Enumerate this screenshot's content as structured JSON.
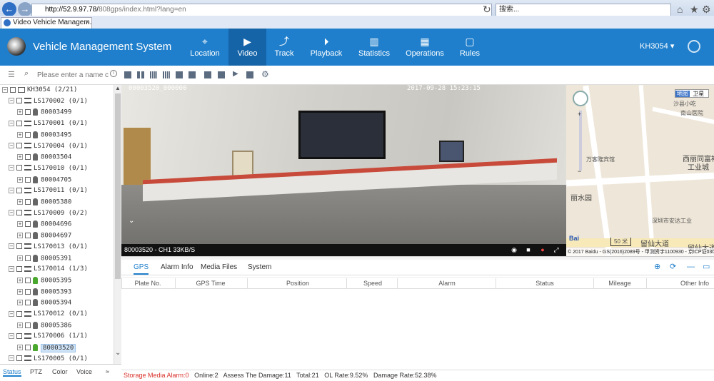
{
  "browser": {
    "url_host": "http://52.9.97.78/",
    "url_path": "808gps/index.html?lang=en",
    "search_placeholder": "搜索...",
    "tab_title": "Video Vehicle Managem..."
  },
  "app": {
    "title": "Vehicle Management System"
  },
  "nav": {
    "items": [
      {
        "label": "Location",
        "icon": "map-pin-icon"
      },
      {
        "label": "Video",
        "icon": "play-circle-icon",
        "active": true
      },
      {
        "label": "Track",
        "icon": "track-icon"
      },
      {
        "label": "Playback",
        "icon": "playback-icon"
      },
      {
        "label": "Statistics",
        "icon": "bar-chart-icon"
      },
      {
        "label": "Operations",
        "icon": "operations-icon"
      },
      {
        "label": "Rules",
        "icon": "rules-icon"
      }
    ]
  },
  "user": {
    "name": "KH3054",
    "caret": "▾"
  },
  "toolbar": {
    "search_placeholder": "Please enter a name c"
  },
  "tree": {
    "root": "KH3054  (2/21)",
    "groups": [
      {
        "name": "LS170002  (0/1)",
        "devices": [
          {
            "id": "80003499",
            "online": false
          }
        ]
      },
      {
        "name": "LS170001  (0/1)",
        "devices": [
          {
            "id": "80003495",
            "online": false
          }
        ]
      },
      {
        "name": "LS170004  (0/1)",
        "devices": [
          {
            "id": "80003504",
            "online": false
          }
        ]
      },
      {
        "name": "LS170010  (0/1)",
        "devices": [
          {
            "id": "80004705",
            "online": false
          }
        ]
      },
      {
        "name": "LS170011  (0/1)",
        "devices": [
          {
            "id": "80005380",
            "online": false
          }
        ]
      },
      {
        "name": "LS170009  (0/2)",
        "devices": [
          {
            "id": "80004696",
            "online": false
          },
          {
            "id": "80004697",
            "online": false
          }
        ]
      },
      {
        "name": "LS170013  (0/1)",
        "devices": [
          {
            "id": "80005391",
            "online": false
          }
        ]
      },
      {
        "name": "LS170014  (1/3)",
        "devices": [
          {
            "id": "80005395",
            "online": true
          },
          {
            "id": "80005393",
            "online": false
          },
          {
            "id": "80005394",
            "online": false
          }
        ]
      },
      {
        "name": "LS170012  (0/1)",
        "devices": [
          {
            "id": "80005386",
            "online": false
          }
        ]
      },
      {
        "name": "LS170006  (1/1)",
        "devices": [
          {
            "id": "80003520",
            "online": true,
            "selected": true
          }
        ]
      },
      {
        "name": "LS170005  (0/1)",
        "devices": []
      }
    ]
  },
  "left_tabs": [
    "Status",
    "PTZ",
    "Color",
    "Voice"
  ],
  "video": {
    "osd_channel": "00003520_000000",
    "osd_datetime": "2017-09-28 15:23:15",
    "caption": "80003520 - CH1 33KB/S"
  },
  "map": {
    "type_map": "地图",
    "type_satellite": "卫星",
    "labels": [
      "沙县小吃",
      "南山医院",
      "万客隆宾馆",
      "西丽同富裕",
      "工业城",
      "丽水园",
      "深圳市安达工业",
      "留仙大道",
      "留仙大道"
    ],
    "scale": "50 米",
    "copyright": "© 2017 Baidu - GS(2016)2089号 - 甲测资字1100930 - 京ICP证030173号"
  },
  "detail_tabs": [
    "GPS",
    "Alarm Info",
    "Media Files",
    "System"
  ],
  "table": {
    "columns": [
      "Plate No.",
      "GPS Time",
      "Position",
      "Speed",
      "Alarm",
      "Status",
      "Mileage",
      "Other Info"
    ]
  },
  "status": {
    "alarm": "Storage Media Alarm:0",
    "online": "Online:2",
    "damage": "Assess The Damage:11",
    "total": "Total:21",
    "ol_rate": "OL Rate:9.52%",
    "damage_rate": "Damage Rate:52.38%"
  },
  "colors": {
    "header": "#1f7fcc",
    "active_nav": "#1564a8",
    "alarm": "#d9302a",
    "online": "#4aa82e"
  }
}
